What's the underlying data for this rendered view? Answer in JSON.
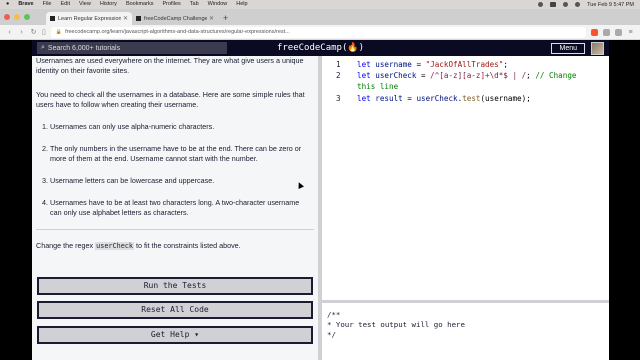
{
  "menubar": {
    "items": [
      "Brave",
      "File",
      "Edit",
      "View",
      "History",
      "Bookmarks",
      "Profiles",
      "Tab",
      "Window",
      "Help"
    ],
    "clock": "Tue Feb 9  5:47 PM"
  },
  "tabs": [
    {
      "label": "Learn Regular Expressions: Re..."
    },
    {
      "label": "freeCodeCamp Challenge Guide:..."
    }
  ],
  "address": {
    "url": "freecodecamp.org/learn/javascript-algorithms-and-data-structures/regular-expressions/rest..."
  },
  "fccnav": {
    "search_placeholder": "Search 6,000+ tutorials",
    "logo": "freeCodeCamp(🔥)",
    "menu_label": "Menu"
  },
  "description": {
    "p1": "Usernames are used everywhere on the internet. They are what give users a unique identity on their favorite sites.",
    "p2": "You need to check all the usernames in a database. Here are some simple rules that users have to follow when creating their username.",
    "rules": [
      "Usernames can only use alpha-numeric characters.",
      "The only numbers in the username have to be at the end. There can be zero or more of them at the end. Username cannot start with the number.",
      "Username letters can be lowercase and uppercase.",
      "Usernames have to be at least two characters long. A two-character username can only use alphabet letters as characters."
    ],
    "change_pre": "Change the regex ",
    "change_code": "userCheck",
    "change_post": " to fit the constraints listed above."
  },
  "buttons": {
    "run": "Run the Tests",
    "reset": "Reset All Code",
    "help": "Get Help ▾"
  },
  "editor": {
    "line_numbers": [
      "1",
      "2",
      "",
      "3"
    ],
    "line1": {
      "kw": "let",
      "name": " username",
      "eq": " = ",
      "str": "\"JackOfAllTrades\"",
      "end": ";"
    },
    "line2": {
      "kw": "let",
      "name": " userCheck",
      "eq": " = ",
      "rx": "/^[a-z][a-z]+\\d*$ | /",
      "end": "; ",
      "cm": "// Change"
    },
    "line2b": {
      "cm": "this line"
    },
    "line3": {
      "kw": "let",
      "name": " result",
      "eq": " = ",
      "obj": "userCheck",
      "dot": ".",
      "fn": "test",
      "args": "(username);"
    }
  },
  "console": {
    "lines": [
      "/**",
      "* Your test output will go here",
      "*/"
    ]
  }
}
